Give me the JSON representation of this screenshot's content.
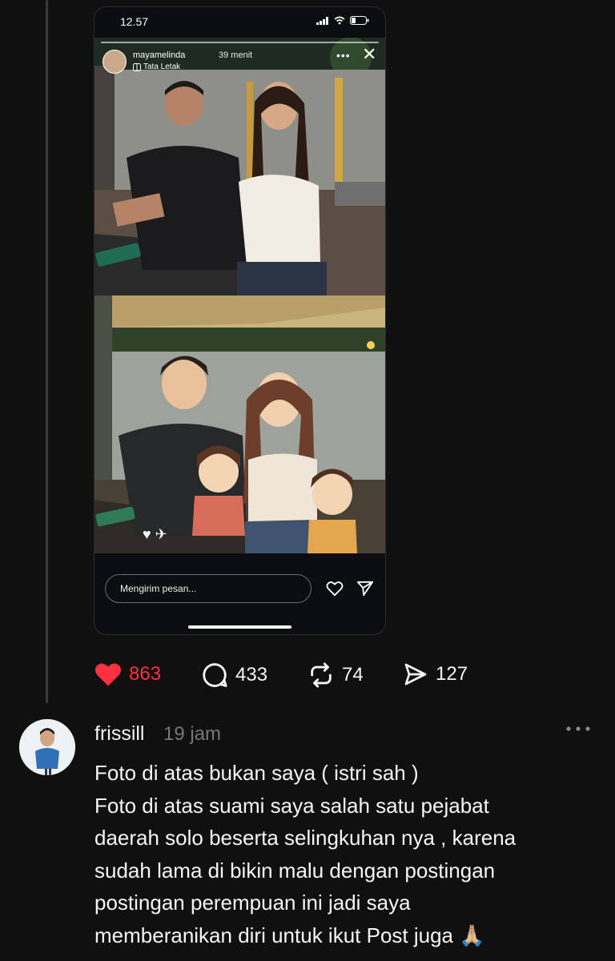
{
  "story": {
    "status_time": "12.57",
    "username": "mayamelinda",
    "time_ago": "39 menit",
    "layout_label": "Tata Letak",
    "message_placeholder": "Mengirim pesan..."
  },
  "actions": {
    "likes": "863",
    "comments": "433",
    "reposts": "74",
    "shares": "127"
  },
  "reply": {
    "username": "frissill",
    "time": "19 jam",
    "lines": [
      "Foto di atas bukan saya ( istri sah )",
      "Foto di atas suami saya salah satu pejabat",
      "daerah solo beserta selingkuhan nya , karena",
      "sudah lama di bikin malu dengan postingan",
      "postingan perempuan ini jadi saya",
      "memberanikan diri untuk ikut Post juga 🙏🏼"
    ]
  },
  "colors": {
    "background": "#101010",
    "like_red": "#ff3040",
    "muted_text": "#777777"
  }
}
